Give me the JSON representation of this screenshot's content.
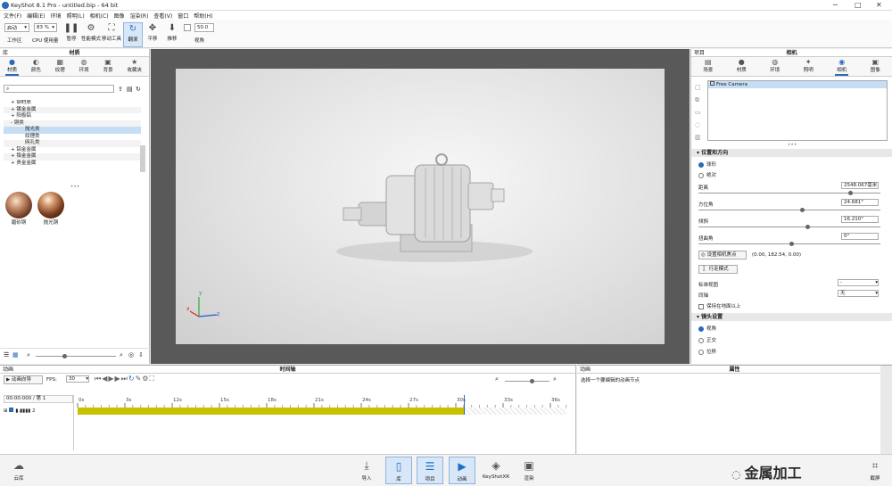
{
  "window": {
    "title": "KeyShot 8.1 Pro - untitled.bip - 64 bit",
    "controls": [
      "─",
      "□",
      "✕"
    ]
  },
  "menu": [
    "文件(F)",
    "编辑(E)",
    "环境",
    "照明(L)",
    "相机(C)",
    "图像",
    "渲染(R)",
    "查看(V)",
    "窗口",
    "帮助(H)"
  ],
  "toolbar": {
    "workspace_value": "启动",
    "cpu_value": "83 %",
    "items": [
      {
        "label": "工作区",
        "icon": "workspace-icon"
      },
      {
        "label": "CPU 使用量",
        "icon": "cpu-icon"
      },
      {
        "label": "暂停",
        "icon": "pause-icon"
      },
      {
        "label": "性能模式",
        "icon": "performance-icon"
      },
      {
        "label": "移动工具",
        "icon": "move-tool-icon"
      },
      {
        "label": "翻滚",
        "icon": "tumble-icon"
      },
      {
        "label": "平移",
        "icon": "pan-icon"
      },
      {
        "label": "推移",
        "icon": "dolly-icon"
      },
      {
        "label": "视角",
        "icon": "fov-icon"
      }
    ],
    "fov_value": "50.0"
  },
  "library": {
    "header_left": "库",
    "title": "材质",
    "tabs": [
      "材质",
      "颜色",
      "纹理",
      "环境",
      "背景",
      "收藏夹"
    ],
    "search_placeholder": "",
    "tree": [
      {
        "label": "+ 钢材质",
        "indent": 1,
        "state": "normal"
      },
      {
        "label": "+ 镀金金属",
        "indent": 1,
        "state": "alt"
      },
      {
        "label": "+ 阳极铝",
        "indent": 1,
        "state": "normal"
      },
      {
        "label": "- 铜类",
        "indent": 1,
        "state": "alt"
      },
      {
        "label": "抛光类",
        "indent": 3,
        "state": "selected"
      },
      {
        "label": "纹理类",
        "indent": 3,
        "state": "normal"
      },
      {
        "label": "网孔类",
        "indent": 3,
        "state": "alt"
      },
      {
        "label": "+ 铝金金属",
        "indent": 1,
        "state": "normal"
      },
      {
        "label": "+ 铬金金属",
        "indent": 1,
        "state": "alt"
      },
      {
        "label": "+ 贵金金属",
        "indent": 1,
        "state": "normal"
      }
    ],
    "materials": [
      "磨砂铜",
      "抛光铜"
    ]
  },
  "project": {
    "header_left": "项目",
    "title": "相机",
    "tabs": [
      "场景",
      "材质",
      "环境",
      "照明",
      "相机",
      "图像"
    ],
    "camera_list": [
      "Free Camera"
    ],
    "section_position": "位置和方向",
    "mode_options": [
      "球形",
      "绝对"
    ],
    "distance_label": "距离",
    "distance_value": "2548.067毫米",
    "azimuth_label": "方位角",
    "azimuth_value": "24.681°",
    "inclination_label": "倾斜",
    "inclination_value": "16.210°",
    "twist_label": "扭曲角",
    "twist_value": "0°",
    "set_focus_label": "设置相机焦点",
    "focus_coords": "(0.00, 182.54, 0.00)",
    "walk_mode_label": "行走模式",
    "std_view_label": "标准视图",
    "std_view_value": "-",
    "sync_label": "同轴",
    "sync_value": "无",
    "keep_above_ground_label": "保持在地面以上",
    "section_lens": "镜头设置",
    "lens_options": [
      "视角",
      "正交",
      "位移"
    ]
  },
  "axes": {
    "x": "x",
    "y": "y",
    "z": "z"
  },
  "animation": {
    "header_left": "动画",
    "title": "时间轴",
    "wizard_label": "动画向导",
    "fps_label": "FPS:",
    "fps_value": "30",
    "timecode": "00:00:000 / 第 1",
    "track_label": "▮.▮▮▮▮ 2",
    "ticks": [
      "0s",
      "3s",
      "12s",
      "15s",
      "18s",
      "21s",
      "24s",
      "27s",
      "30s",
      "33s",
      "36s"
    ]
  },
  "properties": {
    "header_left": "动画",
    "title": "属性",
    "message": "选择一个要编辑的动画节点"
  },
  "bottombar": {
    "left_label": "云库",
    "buttons": [
      "导入",
      "库",
      "项目",
      "动画",
      "KeyShotXR",
      "渲染"
    ],
    "right_label": "截屏"
  },
  "watermark": "金属加工",
  "colors": {
    "accent": "#2a6ab8",
    "timeline_bar": "#c8c000",
    "viewport_bg": "#595959"
  }
}
